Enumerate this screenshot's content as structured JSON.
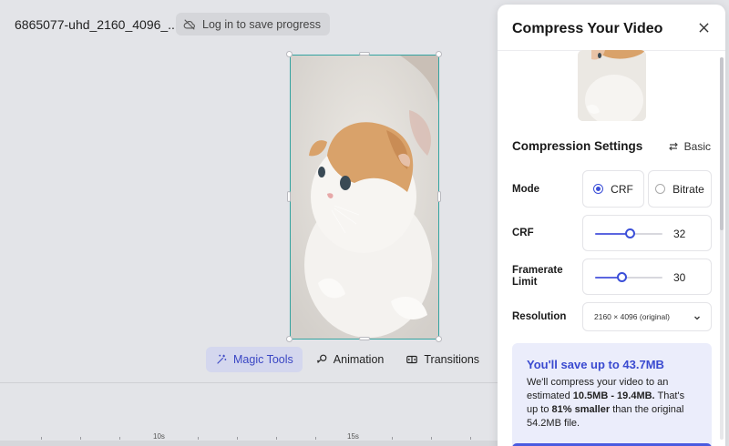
{
  "header": {
    "filename": "6865077-uhd_2160_4096_...",
    "login_label": "Log in to save progress"
  },
  "toolbar": {
    "items": [
      {
        "label": "Magic Tools",
        "icon": "sparkle-icon",
        "active": true
      },
      {
        "label": "Animation",
        "icon": "animation-icon",
        "active": false
      },
      {
        "label": "Transitions",
        "icon": "transitions-icon",
        "active": false
      }
    ],
    "volume_icon": "volume-icon"
  },
  "timeline": {
    "labels": [
      "10s",
      "15s"
    ]
  },
  "panel": {
    "title": "Compress Your Video",
    "section_title": "Compression Settings",
    "basic_label": "Basic",
    "mode": {
      "label": "Mode",
      "options": [
        {
          "label": "CRF",
          "selected": true
        },
        {
          "label": "Bitrate",
          "selected": false
        }
      ]
    },
    "crf": {
      "label": "CRF",
      "value": "32",
      "fraction": 0.52
    },
    "framerate": {
      "label": "Framerate Limit",
      "value": "30",
      "fraction": 0.4
    },
    "resolution": {
      "label": "Resolution",
      "value": "2160 × 4096 (original)"
    },
    "savings": {
      "title": "You'll save up to 43.7MB",
      "line1": "We'll compress your video to an estimated ",
      "range": "10.5MB - 19.4MB.",
      "line2": " That's up to ",
      "percent": "81% smaller",
      "line3": " than the original 54.2MB file."
    }
  },
  "colors": {
    "accent": "#3b4fd8",
    "accent_light": "#ebedfb",
    "frame_border": "#33a3a0"
  }
}
